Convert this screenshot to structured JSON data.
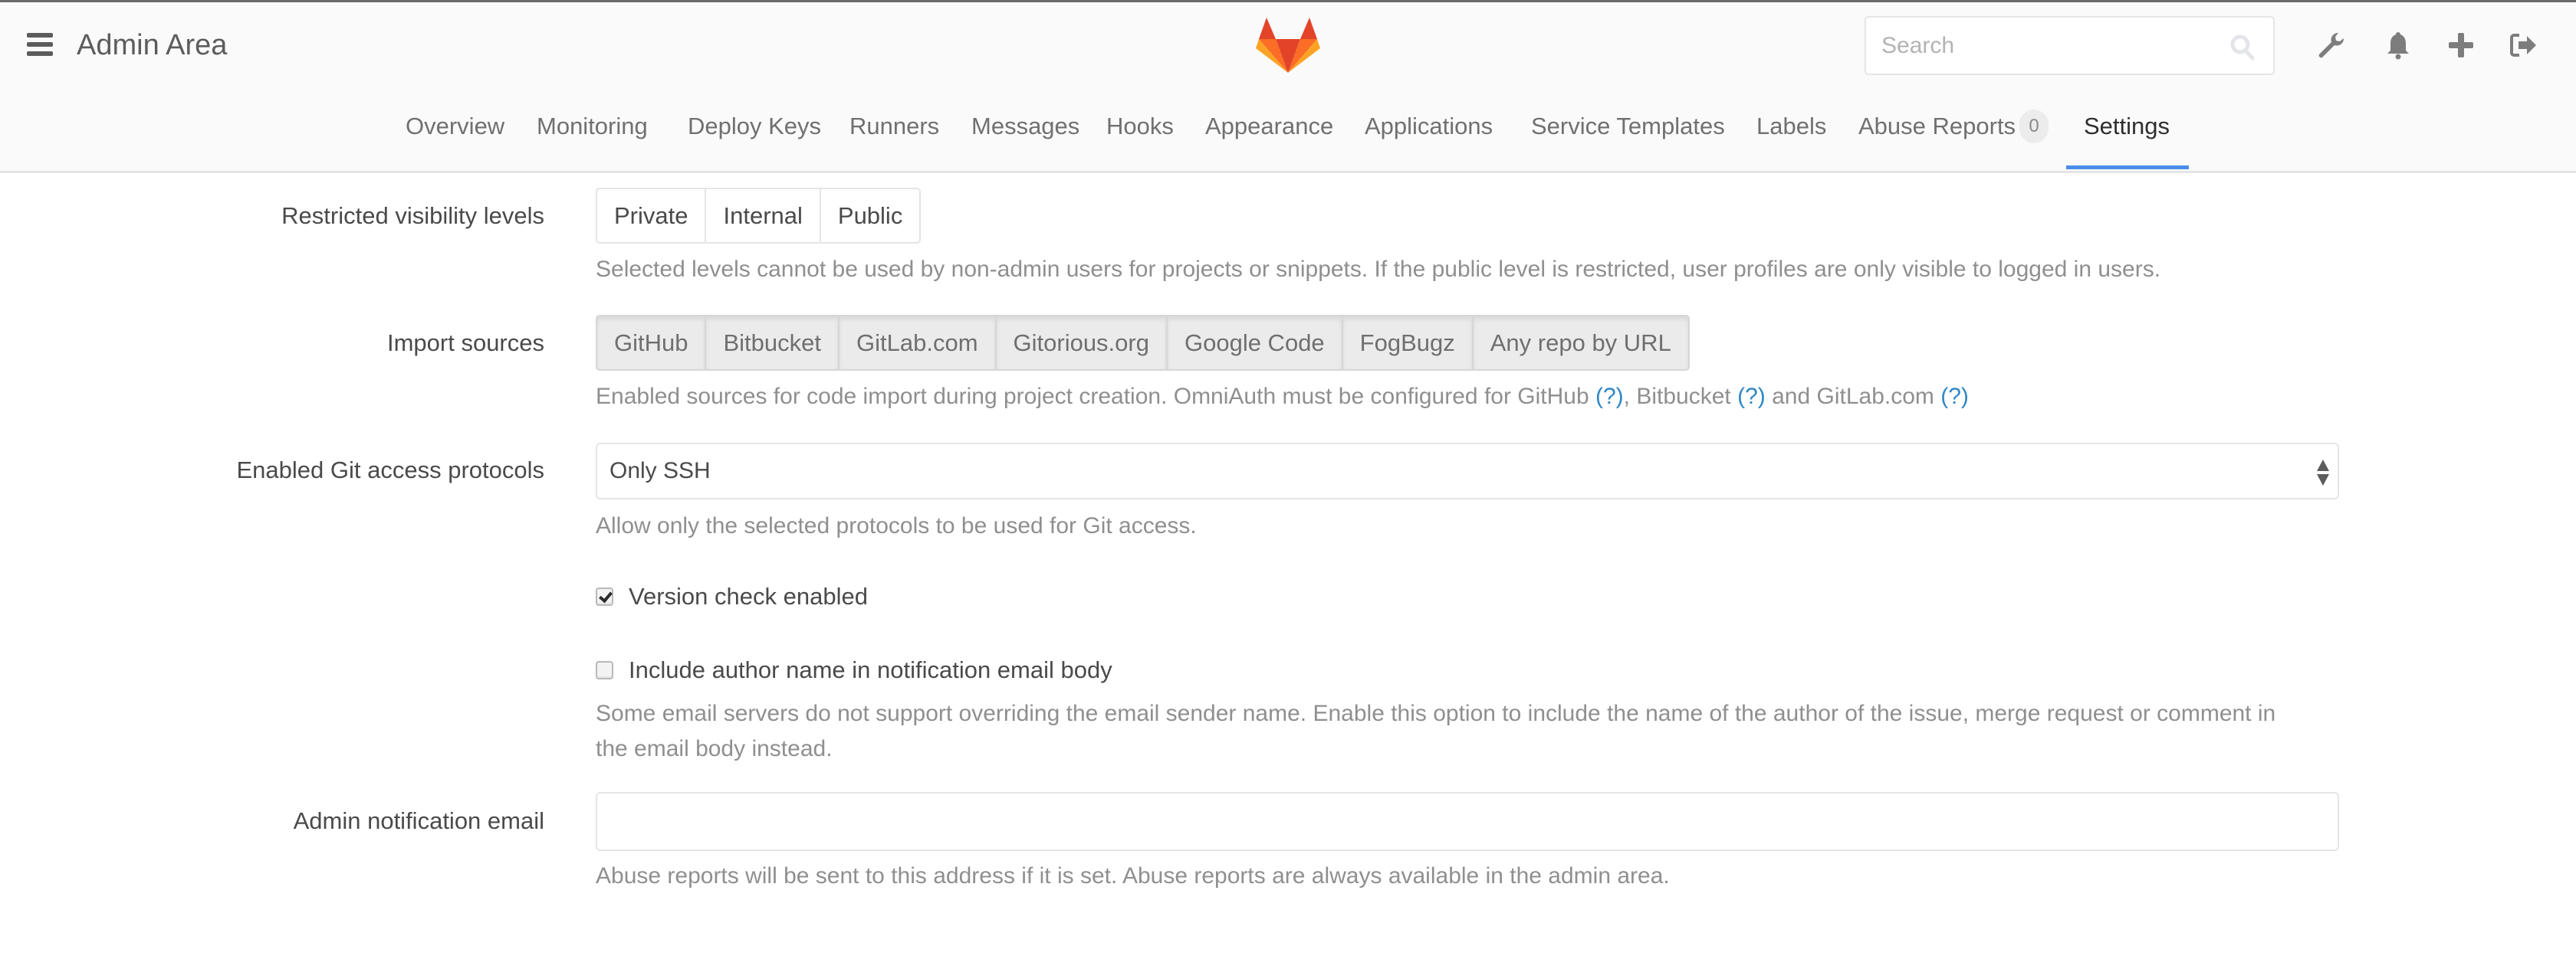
{
  "header": {
    "title": "Admin Area",
    "search_placeholder": "Search",
    "icons": [
      "menu-icon",
      "gitlab-logo",
      "search-icon",
      "wrench-icon",
      "bell-icon",
      "plus-icon",
      "sign-out-icon"
    ]
  },
  "nav": {
    "tabs": [
      {
        "label": "Overview"
      },
      {
        "label": "Monitoring"
      },
      {
        "label": "Deploy Keys"
      },
      {
        "label": "Runners"
      },
      {
        "label": "Messages"
      },
      {
        "label": "Hooks"
      },
      {
        "label": "Appearance"
      },
      {
        "label": "Applications"
      },
      {
        "label": "Service Templates"
      },
      {
        "label": "Labels"
      },
      {
        "label": "Abuse Reports",
        "badge": "0"
      },
      {
        "label": "Settings",
        "active": true
      }
    ]
  },
  "settings": {
    "visibility": {
      "label": "Restricted visibility levels",
      "options": [
        "Private",
        "Internal",
        "Public"
      ],
      "help": "Selected levels cannot be used by non-admin users for projects or snippets. If the public level is restricted, user profiles are only visible to logged in users."
    },
    "import": {
      "label": "Import sources",
      "options": [
        "GitHub",
        "Bitbucket",
        "GitLab.com",
        "Gitorious.org",
        "Google Code",
        "FogBugz",
        "Any repo by URL"
      ],
      "help_prefix": "Enabled sources for code import during project creation. OmniAuth must be configured for GitHub",
      "help_link": "(?)",
      "help_mid1": ", Bitbucket",
      "help_mid2": "and GitLab.com"
    },
    "git_access": {
      "label": "Enabled Git access protocols",
      "value": "Only SSH",
      "help": "Allow only the selected protocols to be used for Git access."
    },
    "version_check": {
      "label": "Version check enabled",
      "checked": true
    },
    "author_name": {
      "label": "Include author name in notification email body",
      "checked": false,
      "help_line1": "Some email servers do not support overriding the email sender name. Enable this option to include the name of the author of the issue, merge request or comment in",
      "help_line2": "the email body instead."
    },
    "admin_email": {
      "label": "Admin notification email",
      "value": "",
      "help": "Abuse reports will be sent to this address if it is set. Abuse reports are always available in the admin area."
    }
  },
  "colors": {
    "accent": "#4a8ee8",
    "link": "#2e87c6",
    "logo_red": "#e24329",
    "logo_orange": "#fc6d26",
    "logo_yellow": "#fca326"
  }
}
